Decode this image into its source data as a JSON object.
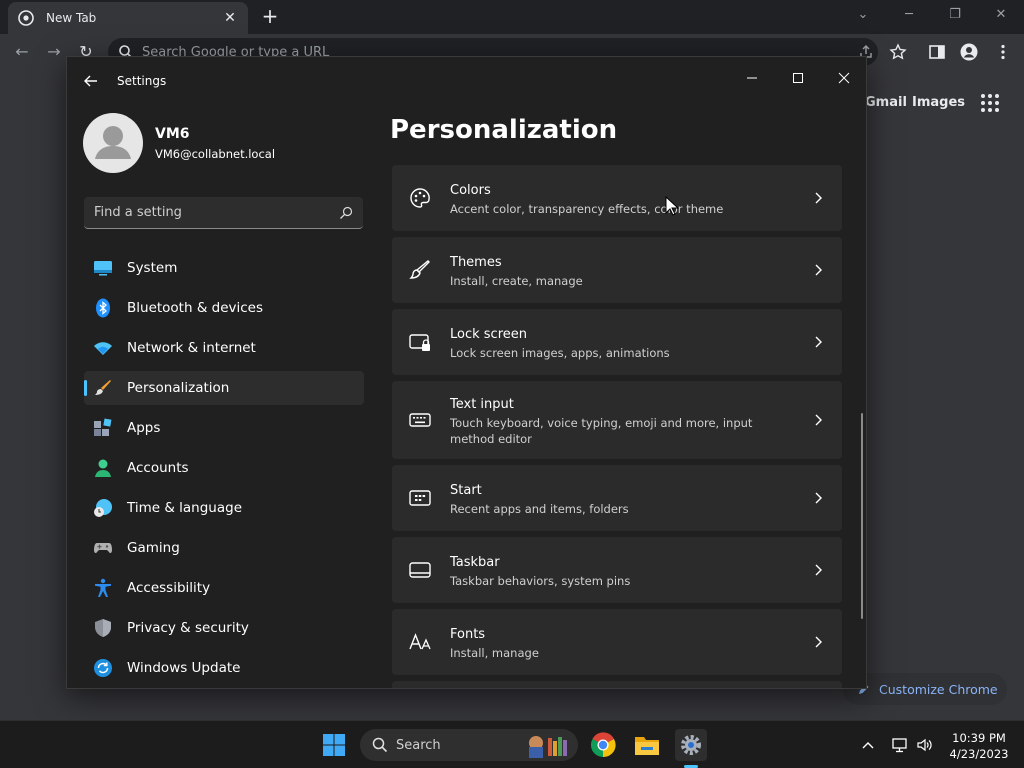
{
  "chrome": {
    "tab_title": "New Tab",
    "omnibox_placeholder": "Search Google or type a URL",
    "gmail_label": "Gmail",
    "images_label": "Images",
    "customize_label": "Customize Chrome"
  },
  "settings": {
    "window_title": "Settings",
    "profile": {
      "name": "VM6",
      "email": "VM6@collabnet.local"
    },
    "search_placeholder": "Find a setting",
    "nav": [
      {
        "label": "System",
        "icon": "system-icon",
        "selected": false
      },
      {
        "label": "Bluetooth & devices",
        "icon": "bluetooth-icon",
        "selected": false
      },
      {
        "label": "Network & internet",
        "icon": "wifi-icon",
        "selected": false
      },
      {
        "label": "Personalization",
        "icon": "paintbrush-icon",
        "selected": true
      },
      {
        "label": "Apps",
        "icon": "apps-icon",
        "selected": false
      },
      {
        "label": "Accounts",
        "icon": "person-icon",
        "selected": false
      },
      {
        "label": "Time & language",
        "icon": "clock-globe-icon",
        "selected": false
      },
      {
        "label": "Gaming",
        "icon": "gamepad-icon",
        "selected": false
      },
      {
        "label": "Accessibility",
        "icon": "accessibility-icon",
        "selected": false
      },
      {
        "label": "Privacy & security",
        "icon": "shield-icon",
        "selected": false
      },
      {
        "label": "Windows Update",
        "icon": "update-icon",
        "selected": false
      }
    ],
    "heading": "Personalization",
    "cards": [
      {
        "title": "Colors",
        "desc": "Accent color, transparency effects, color theme",
        "icon": "palette-icon"
      },
      {
        "title": "Themes",
        "desc": "Install, create, manage",
        "icon": "brush-icon"
      },
      {
        "title": "Lock screen",
        "desc": "Lock screen images, apps, animations",
        "icon": "lock-screen-icon"
      },
      {
        "title": "Text input",
        "desc": "Touch keyboard, voice typing, emoji and more, input method editor",
        "icon": "keyboard-icon"
      },
      {
        "title": "Start",
        "desc": "Recent apps and items, folders",
        "icon": "start-icon"
      },
      {
        "title": "Taskbar",
        "desc": "Taskbar behaviors, system pins",
        "icon": "taskbar-icon"
      },
      {
        "title": "Fonts",
        "desc": "Install, manage",
        "icon": "fonts-icon"
      }
    ]
  },
  "taskbar": {
    "search_label": "Search",
    "time": "10:39 PM",
    "date": "4/23/2023"
  },
  "colors": {
    "accent": "#4cc2ff",
    "settings_bg": "#202020",
    "card_bg": "#2b2b2b",
    "chrome_link": "#8ab4f8"
  }
}
